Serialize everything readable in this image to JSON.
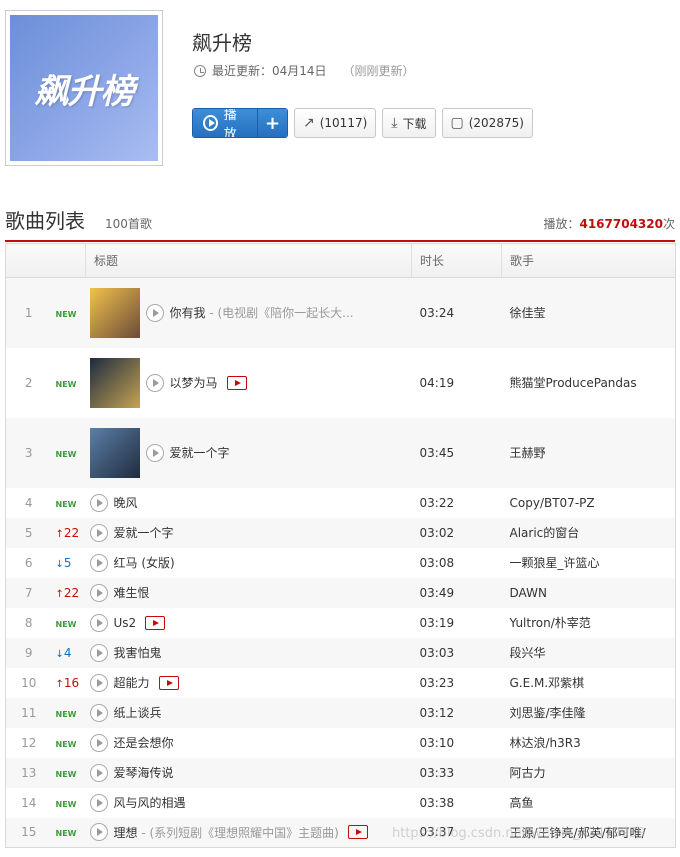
{
  "header": {
    "cover_text": "飙升榜",
    "title": "飙升榜",
    "update_label": "最近更新：04月14日",
    "update_note": "（刚刚更新）",
    "buttons": {
      "play": "播放",
      "add": "+",
      "share": "(10117)",
      "download": "下载",
      "comment": "(202875)"
    }
  },
  "list": {
    "title": "歌曲列表",
    "count": "100首歌",
    "play_label": "播放：",
    "play_count": "4167704320",
    "play_suffix": "次",
    "columns": [
      "",
      "",
      "标题",
      "时长",
      "歌手"
    ]
  },
  "songs": [
    {
      "rank": "1",
      "trend": "NEW",
      "title": "你有我",
      "subtitle": " - (电视剧《陪你一起长大...",
      "duration": "03:24",
      "singer": "徐佳莹",
      "thumb": true,
      "mv": false
    },
    {
      "rank": "2",
      "trend": "NEW",
      "title": "以梦为马",
      "subtitle": "",
      "duration": "04:19",
      "singer": "熊猫堂ProducePandas",
      "thumb": true,
      "mv": true
    },
    {
      "rank": "3",
      "trend": "NEW",
      "title": "爱就一个字",
      "subtitle": "",
      "duration": "03:45",
      "singer": "王赫野",
      "thumb": true,
      "mv": false
    },
    {
      "rank": "4",
      "trend": "NEW",
      "title": "晚风",
      "subtitle": "",
      "duration": "03:22",
      "singer": "Copy/BT07-PZ",
      "thumb": false,
      "mv": false
    },
    {
      "rank": "5",
      "trend": "22",
      "trend_dir": "up",
      "title": "爱就一个字",
      "subtitle": "",
      "duration": "03:02",
      "singer": "Alaric的窗台",
      "thumb": false,
      "mv": false
    },
    {
      "rank": "6",
      "trend": "5",
      "trend_dir": "down",
      "title": "红马 (女版)",
      "subtitle": "",
      "duration": "03:08",
      "singer": "一颗狼星_许篮心",
      "thumb": false,
      "mv": false
    },
    {
      "rank": "7",
      "trend": "22",
      "trend_dir": "up",
      "title": "难生恨",
      "subtitle": "",
      "duration": "03:49",
      "singer": "DAWN",
      "thumb": false,
      "mv": false
    },
    {
      "rank": "8",
      "trend": "NEW",
      "title": "Us2",
      "subtitle": "",
      "duration": "03:19",
      "singer": "Yultron/朴宰范",
      "thumb": false,
      "mv": true
    },
    {
      "rank": "9",
      "trend": "4",
      "trend_dir": "down",
      "title": "我害怕鬼",
      "subtitle": "",
      "duration": "03:03",
      "singer": "段兴华",
      "thumb": false,
      "mv": false
    },
    {
      "rank": "10",
      "trend": "16",
      "trend_dir": "up",
      "title": "超能力",
      "subtitle": "",
      "duration": "03:23",
      "singer": "G.E.M.邓紫棋",
      "thumb": false,
      "mv": true
    },
    {
      "rank": "11",
      "trend": "NEW",
      "title": "纸上谈兵",
      "subtitle": "",
      "duration": "03:12",
      "singer": "刘思鉴/李佳隆",
      "thumb": false,
      "mv": false
    },
    {
      "rank": "12",
      "trend": "NEW",
      "title": "还是会想你",
      "subtitle": "",
      "duration": "03:10",
      "singer": "林达浪/h3R3",
      "thumb": false,
      "mv": false
    },
    {
      "rank": "13",
      "trend": "NEW",
      "title": "爱琴海传说",
      "subtitle": "",
      "duration": "03:33",
      "singer": "阿古力",
      "thumb": false,
      "mv": false
    },
    {
      "rank": "14",
      "trend": "NEW",
      "title": "风与风的相遇",
      "subtitle": "",
      "duration": "03:38",
      "singer": "高鱼",
      "thumb": false,
      "mv": false
    },
    {
      "rank": "15",
      "trend": "NEW",
      "title": "理想",
      "subtitle": " - (系列短剧《理想照耀中国》主题曲)",
      "duration": "03:37",
      "singer": "王源/王铮亮/郝英/郁可唯/",
      "thumb": false,
      "mv": true
    }
  ],
  "watermark": "https://blog.csdn.net/weixin_43479939",
  "colors": {
    "accent": "#c20c0c",
    "play_blue": "#2670bf",
    "new_green": "#3a9d3a",
    "down_blue": "#0c73c2"
  }
}
